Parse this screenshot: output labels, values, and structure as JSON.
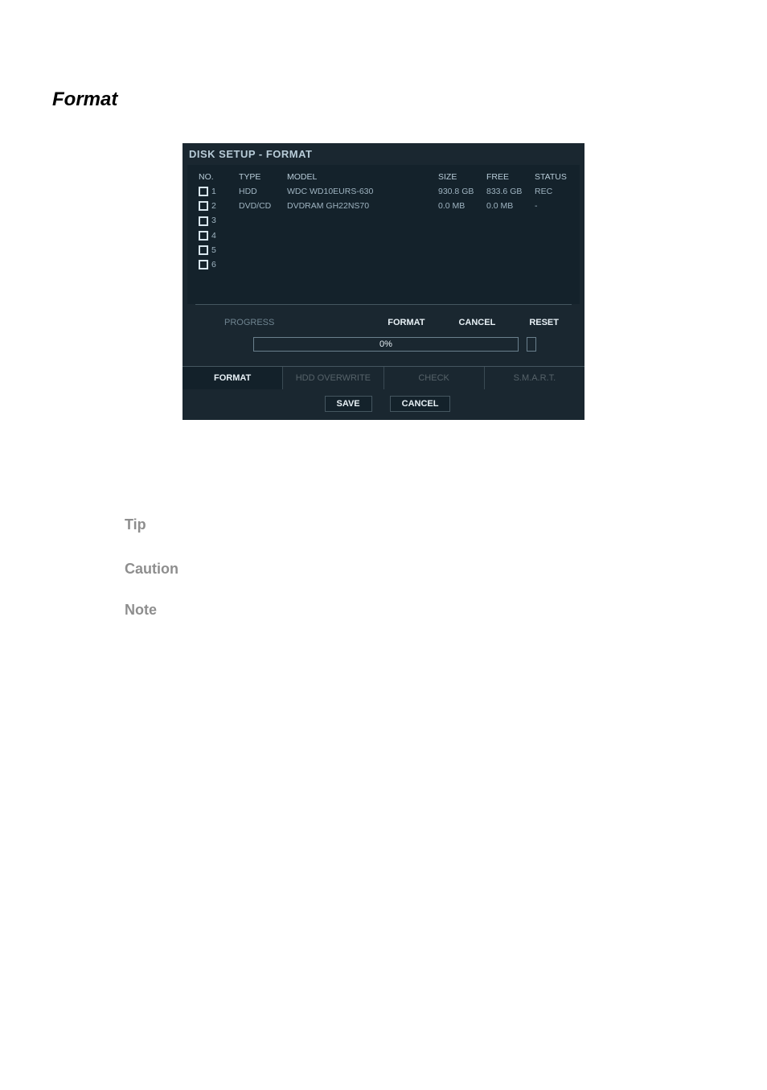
{
  "section_title": "Format",
  "dialog": {
    "title": "DISK SETUP - FORMAT",
    "headers": {
      "no": "NO.",
      "type": "TYPE",
      "model": "MODEL",
      "size": "SIZE",
      "free": "FREE",
      "status": "STATUS"
    },
    "rows": [
      {
        "no": "1",
        "type": "HDD",
        "model": "WDC WD10EURS-630",
        "size": "930.8 GB",
        "free": "833.6 GB",
        "status": "REC"
      },
      {
        "no": "2",
        "type": "DVD/CD",
        "model": "DVDRAM GH22NS70",
        "size": "0.0 MB",
        "free": "0.0 MB",
        "status": "-"
      },
      {
        "no": "3",
        "type": "",
        "model": "",
        "size": "",
        "free": "",
        "status": ""
      },
      {
        "no": "4",
        "type": "",
        "model": "",
        "size": "",
        "free": "",
        "status": ""
      },
      {
        "no": "5",
        "type": "",
        "model": "",
        "size": "",
        "free": "",
        "status": ""
      },
      {
        "no": "6",
        "type": "",
        "model": "",
        "size": "",
        "free": "",
        "status": ""
      }
    ],
    "actions": {
      "format": "FORMAT",
      "cancel": "CANCEL",
      "reset": "RESET"
    },
    "progress_label": "PROGRESS",
    "progress_text": "0%",
    "tabs": {
      "format": "FORMAT",
      "hdd_overwrite": "HDD OVERWRITE",
      "check": "CHECK",
      "smart": "S.M.A.R.T."
    },
    "bottom": {
      "save": "SAVE",
      "cancel": "CANCEL"
    }
  },
  "tip_heading": "Tip",
  "caution_heading": "Caution",
  "note_heading": "Note"
}
